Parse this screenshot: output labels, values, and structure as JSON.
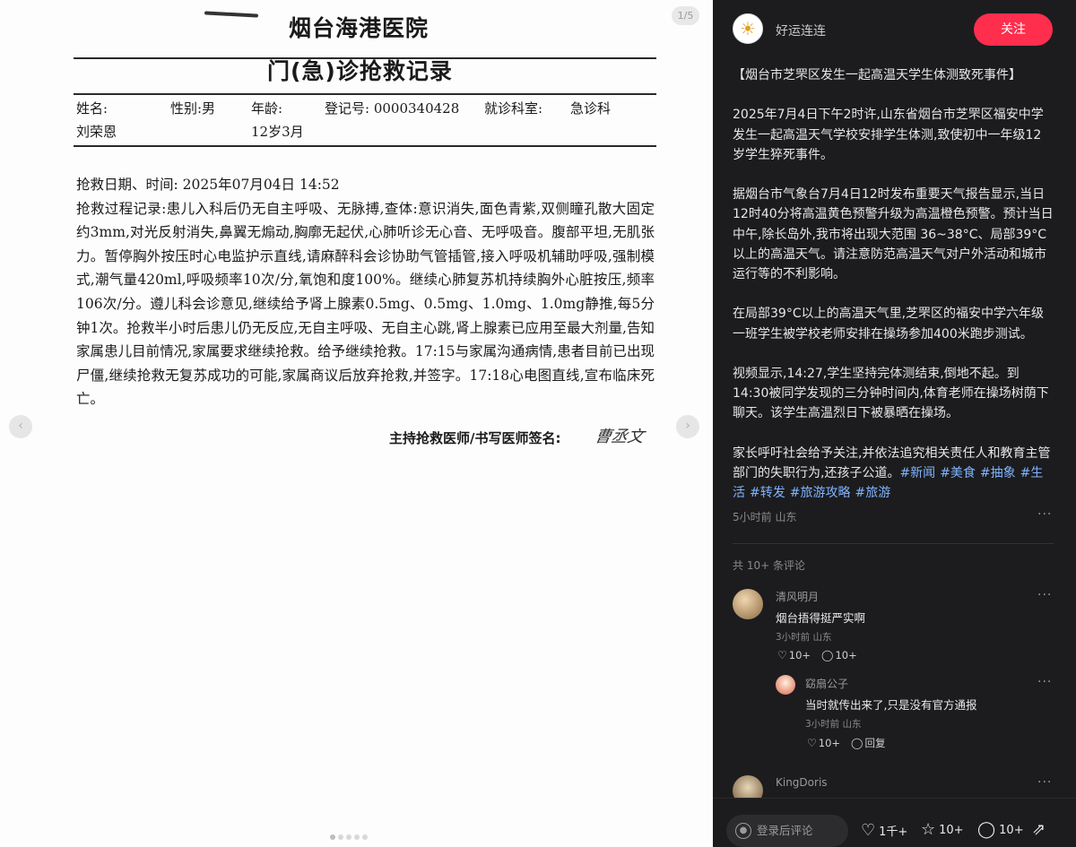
{
  "viewer": {
    "counter": "1/5",
    "prev_icon": "‹",
    "next_icon": "›",
    "dots": 5,
    "active_dot": 0
  },
  "document": {
    "hospital": "烟台海港医院",
    "title": "门(急)诊抢救记录",
    "fields": {
      "name_label": "姓名:",
      "name_value": "刘荣恩",
      "gender": "性别:男",
      "age_label": "年龄:",
      "age_value": "12岁3月",
      "reg_no": "登记号: 0000340428",
      "dept_label": "就诊科室:",
      "dept_value": "急诊科"
    },
    "body": [
      "抢救日期、时间:  2025年07月04日 14:52",
      "抢救过程记录:患儿入科后仍无自主呼吸、无脉搏,查体:意识消失,面色青紫,双侧瞳孔散大固定约3mm,对光反射消失,鼻翼无煽动,胸廓无起伏,心肺听诊无心音、无呼吸音。腹部平坦,无肌张力。暂停胸外按压时心电监护示直线,请麻醉科会诊协助气管插管,接入呼吸机辅助呼吸,强制模式,潮气量420ml,呼吸频率10次/分,氧饱和度100%。继续心肺复苏机持续胸外心脏按压,频率106次/分。遵儿科会诊意见,继续给予肾上腺素0.5mg、0.5mg、1.0mg、1.0mg静推,每5分钟1次。抢救半小时后患儿仍无反应,无自主呼吸、无自主心跳,肾上腺素已应用至最大剂量,告知家属患儿目前情况,家属要求继续抢救。给予继续抢救。17:15与家属沟通病情,患者目前已出现尸僵,继续抢救无复苏成功的可能,家属商议后放弃抢救,并签字。17:18心电图直线,宣布临床死亡。"
    ],
    "sign_label": "主持抢救医师/书写医师签名:",
    "signature": "曹丞文"
  },
  "panel": {
    "author": {
      "name": "好运连连",
      "avatar_icon": "☀"
    },
    "follow_label": "关注",
    "post": {
      "paragraphs": [
        "【烟台市芝罘区发生一起高温天学生体测致死事件】",
        "2025年7月4日下午2时许,山东省烟台市芝罘区福安中学发生一起高温天气学校安排学生体测,致使初中一年级12岁学生猝死事件。",
        "据烟台市气象台7月4日12时发布重要天气报告显示,当日12时40分将高温黄色预警升级为高温橙色预警。预计当日中午,除长岛外,我市将出现大范围 36~38°C、局部39°C以上的高温天气。请注意防范高温天气对户外活动和城市运行等的不利影响。",
        "在局部39°C以上的高温天气里,芝罘区的福安中学六年级一班学生被学校老师安排在操场参加400米跑步测试。",
        "视频显示,14:27,学生坚持完体测结束,倒地不起。到14:30被同学发现的三分钟时间内,体育老师在操场树荫下聊天。该学生高温烈日下被暴晒在操场。"
      ],
      "last_paragraph": "家长呼吁社会给予关注,并依法追究相关责任人和教育主管部门的失职行为,还孩子公道。",
      "tags": [
        "#新闻",
        "#美食",
        "#抽象",
        "#生活",
        "#转发",
        "#旅游攻略",
        "#旅游"
      ],
      "meta": "5小时前 山东"
    },
    "more_icon": "···",
    "comments_count": "共 10+ 条评论",
    "comments": [
      {
        "name": "清风明月",
        "text": "烟台捂得挺严实啊",
        "meta": "3小时前 山东",
        "likes": "10+",
        "replies": "10+"
      },
      {
        "name": "窈扇公子",
        "text": "当时就传出来了,只是没有官方通报",
        "meta": "3小时前 山东",
        "likes": "10+",
        "reply_label": "回复"
      },
      {
        "name": "KingDoris"
      }
    ],
    "bottom_bar": {
      "comment_placeholder": "登录后评论",
      "likes": "1千+",
      "favorites": "10+",
      "comments": "10+"
    }
  }
}
